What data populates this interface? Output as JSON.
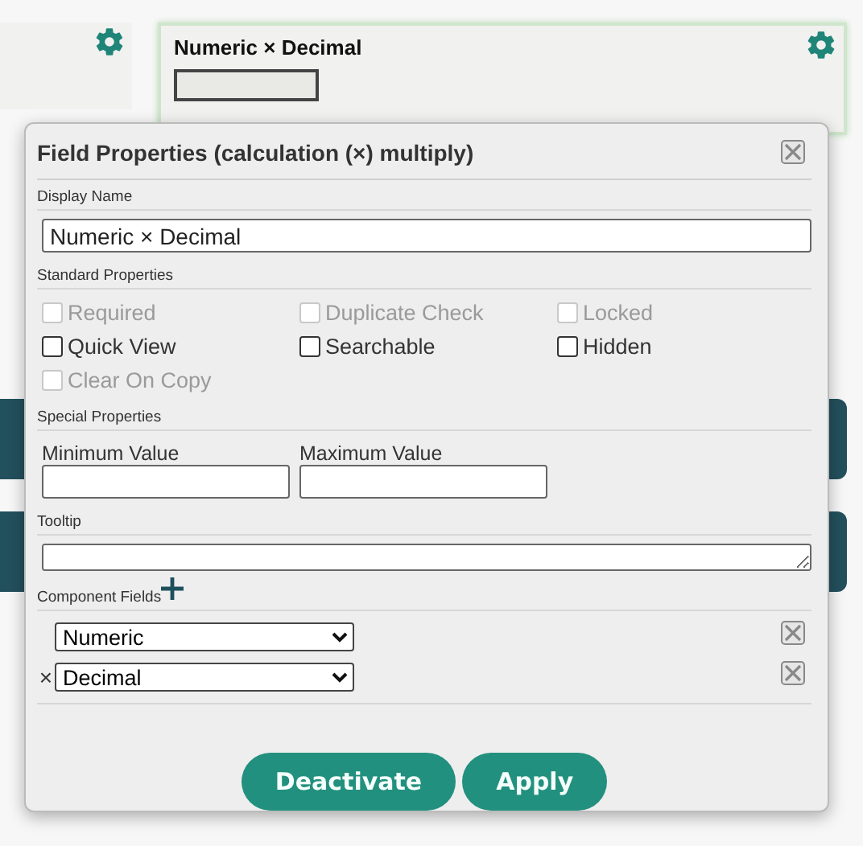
{
  "background_card": {
    "title": "Numeric × Decimal"
  },
  "dialog": {
    "title": "Field Properties (calculation (×) multiply)",
    "display_name": {
      "label": "Display Name",
      "value": "Numeric × Decimal"
    },
    "standard_properties": {
      "label": "Standard Properties",
      "options": [
        {
          "label": "Required",
          "checked": false,
          "disabled": true
        },
        {
          "label": "Duplicate Check",
          "checked": false,
          "disabled": true
        },
        {
          "label": "Locked",
          "checked": false,
          "disabled": true
        },
        {
          "label": "Quick View",
          "checked": false,
          "disabled": false
        },
        {
          "label": "Searchable",
          "checked": false,
          "disabled": false
        },
        {
          "label": "Hidden",
          "checked": false,
          "disabled": false
        },
        {
          "label": "Clear On Copy",
          "checked": false,
          "disabled": true
        }
      ]
    },
    "special_properties": {
      "label": "Special Properties",
      "fields": [
        {
          "label": "Minimum Value"
        },
        {
          "label": "Maximum Value"
        }
      ]
    },
    "tooltip": {
      "label": "Tooltip"
    },
    "component_fields": {
      "label": "Component Fields",
      "rows": [
        {
          "value": "Numeric"
        },
        {
          "operator": "×",
          "value": "Decimal"
        }
      ]
    },
    "buttons": [
      "Deactivate",
      "Apply"
    ]
  }
}
